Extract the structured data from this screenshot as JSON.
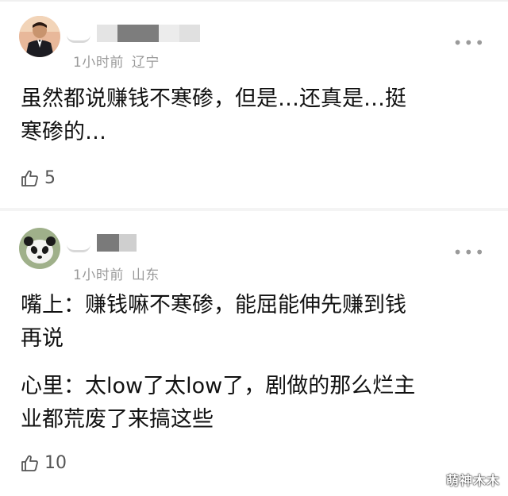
{
  "comments": [
    {
      "time": "1小时前",
      "location": "辽宁",
      "text": "虽然都说赚钱不寒碜，但是…还真是…挺\n寒碜的…",
      "likes": "5",
      "more_icon": "more-dots-icon",
      "like_icon": "thumbs-up-icon"
    },
    {
      "time": "1小时前",
      "location": "山东",
      "text_a": "嘴上：赚钱嘛不寒碜，能屈能伸先赚到钱\n再说",
      "text_b": "心里：太low了太low了，剧做的那么烂主\n业都荒废了来搞这些",
      "likes": "10",
      "more_icon": "more-dots-icon",
      "like_icon": "thumbs-up-icon"
    }
  ],
  "watermark": "萌神木木",
  "colors": {
    "meta": "#9a9a9a",
    "text": "#111111",
    "divider": "#f4f4f4"
  }
}
